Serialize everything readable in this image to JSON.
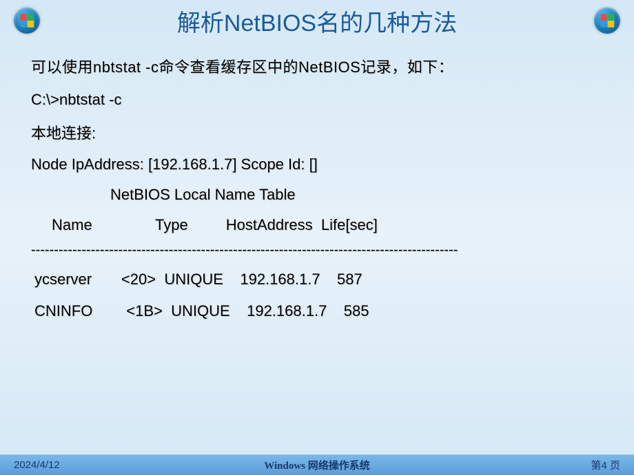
{
  "header": {
    "title": "解析NetBIOS名的几种方法"
  },
  "content": {
    "intro": "可以使用nbtstat   -c命令查看缓存区中的NetBIOS记录，如下：",
    "command": "C:\\>nbtstat -c",
    "connection": "本地连接:",
    "node_info": "Node IpAddress: [192.168.1.7] Scope Id: []",
    "table_title": "NetBIOS Local Name Table",
    "col_name": "Name",
    "col_type": "Type",
    "col_host": "HostAddress",
    "col_life": "Life[sec]",
    "divider": "---------------------------------------------------------------------------------------------",
    "rows": [
      {
        "name": "ycserver",
        "code": "<20>",
        "type": "UNIQUE",
        "host": "192.168.1.7",
        "life": "587"
      },
      {
        "name": "CNINFO",
        "code": "<1B>",
        "type": "UNIQUE",
        "host": "192.168.1.7",
        "life": "585"
      }
    ]
  },
  "footer": {
    "date": "2024/4/12",
    "center": "Windows 网络操作系统",
    "page": "第4 页"
  }
}
